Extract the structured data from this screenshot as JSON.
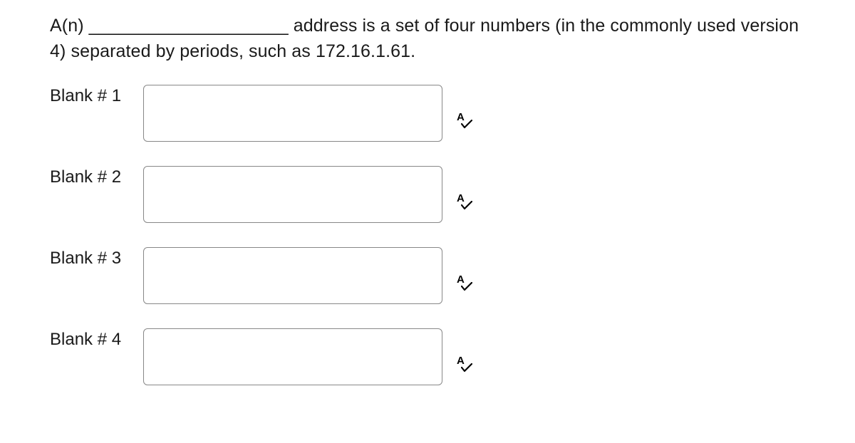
{
  "question": "A(n) ____________________ address is a set of four numbers (in the commonly used version 4) separated by periods, such as 172.16.1.61.",
  "blanks": [
    {
      "label": "Blank # 1",
      "value": ""
    },
    {
      "label": "Blank # 2",
      "value": ""
    },
    {
      "label": "Blank # 3",
      "value": ""
    },
    {
      "label": "Blank # 4",
      "value": ""
    }
  ],
  "icons": {
    "spellcheck": "A✓"
  }
}
